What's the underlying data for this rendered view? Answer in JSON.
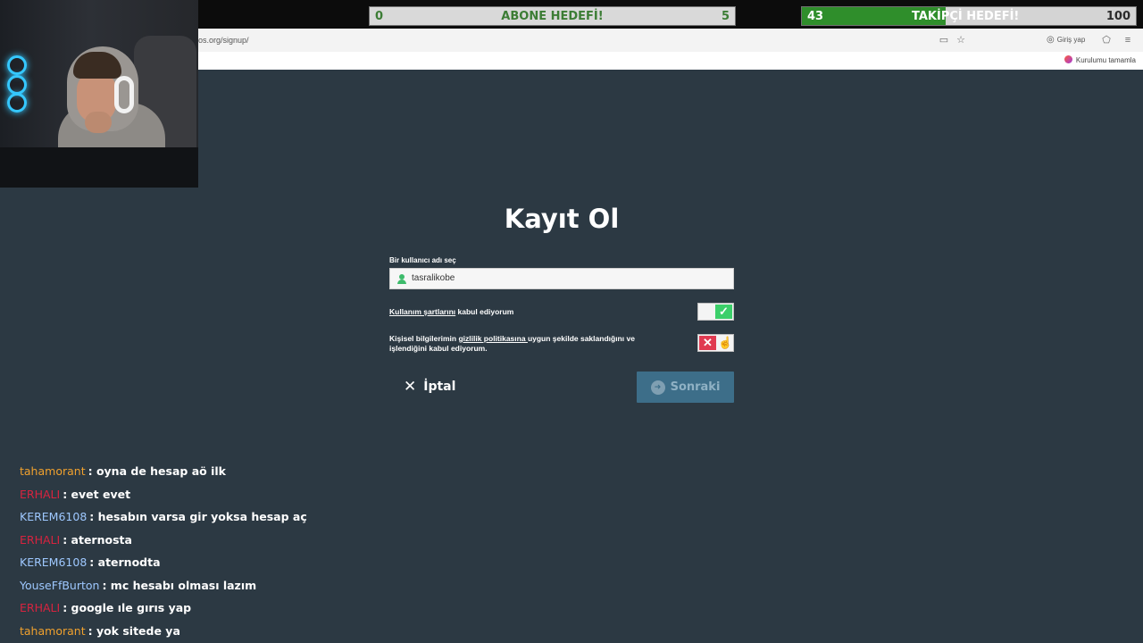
{
  "stream": {
    "goals": {
      "abone": {
        "current": "0",
        "title": "ABONE HEDEFİ!",
        "target": "5",
        "progress": 0
      },
      "takipci": {
        "current": "43",
        "title": "TAKİPÇİ HEDEFİ!",
        "target": "100",
        "progress": 0.43
      }
    }
  },
  "browser": {
    "url": "os.org/signup/",
    "login_label": "Giriş yap",
    "setup_label": "Kurulumu tamamla",
    "icons": {
      "reader": "reader-view-icon",
      "bookmark": "star-icon",
      "account": "account-icon",
      "extensions": "extensions-icon",
      "menu": "hamburger-menu-icon"
    }
  },
  "form": {
    "title": "Kayıt Ol",
    "username_label": "Bir kullanıcı adı seç",
    "username_value": "tasralikobe",
    "terms": {
      "link": "Kullanım şartlarını",
      "text": " kabul ediyorum",
      "accepted": true
    },
    "privacy": {
      "prefix": "Kişisel bilgilerimin ",
      "link": "gizlilik politikasına ",
      "suffix": "uygun şekilde saklandığını ve işlendiğini kabul ediyorum.",
      "accepted": false
    },
    "cancel_label": "İptal",
    "next_label": "Sonraki"
  },
  "chat": [
    {
      "user": "tahamorant",
      "color": "#f0a12e",
      "message": ": oyna de hesap aö ilk"
    },
    {
      "user": "ERHALI",
      "color": "#d8233f",
      "message": ": evet evet"
    },
    {
      "user": "KEREM6108",
      "color": "#9ec8ff",
      "message": ": hesabın varsa gir yoksa hesap aç"
    },
    {
      "user": "ERHALI",
      "color": "#d8233f",
      "message": ": aternosta"
    },
    {
      "user": "KEREM6108",
      "color": "#9ec8ff",
      "message": ": aternodta"
    },
    {
      "user": "YouseFfBurton",
      "color": "#9ec8ff",
      "message": ": mc hesabı olması lazım"
    },
    {
      "user": "ERHALI",
      "color": "#d8233f",
      "message": ": google ıle gırıs yap"
    },
    {
      "user": "tahamorant",
      "color": "#f0a12e",
      "message": ": yok sitede ya"
    }
  ],
  "colors": {
    "page_bg": "#2c3943",
    "accept_green": "#3ccf6a",
    "reject_red": "#e03a51",
    "next_button": "#3d6e89"
  }
}
